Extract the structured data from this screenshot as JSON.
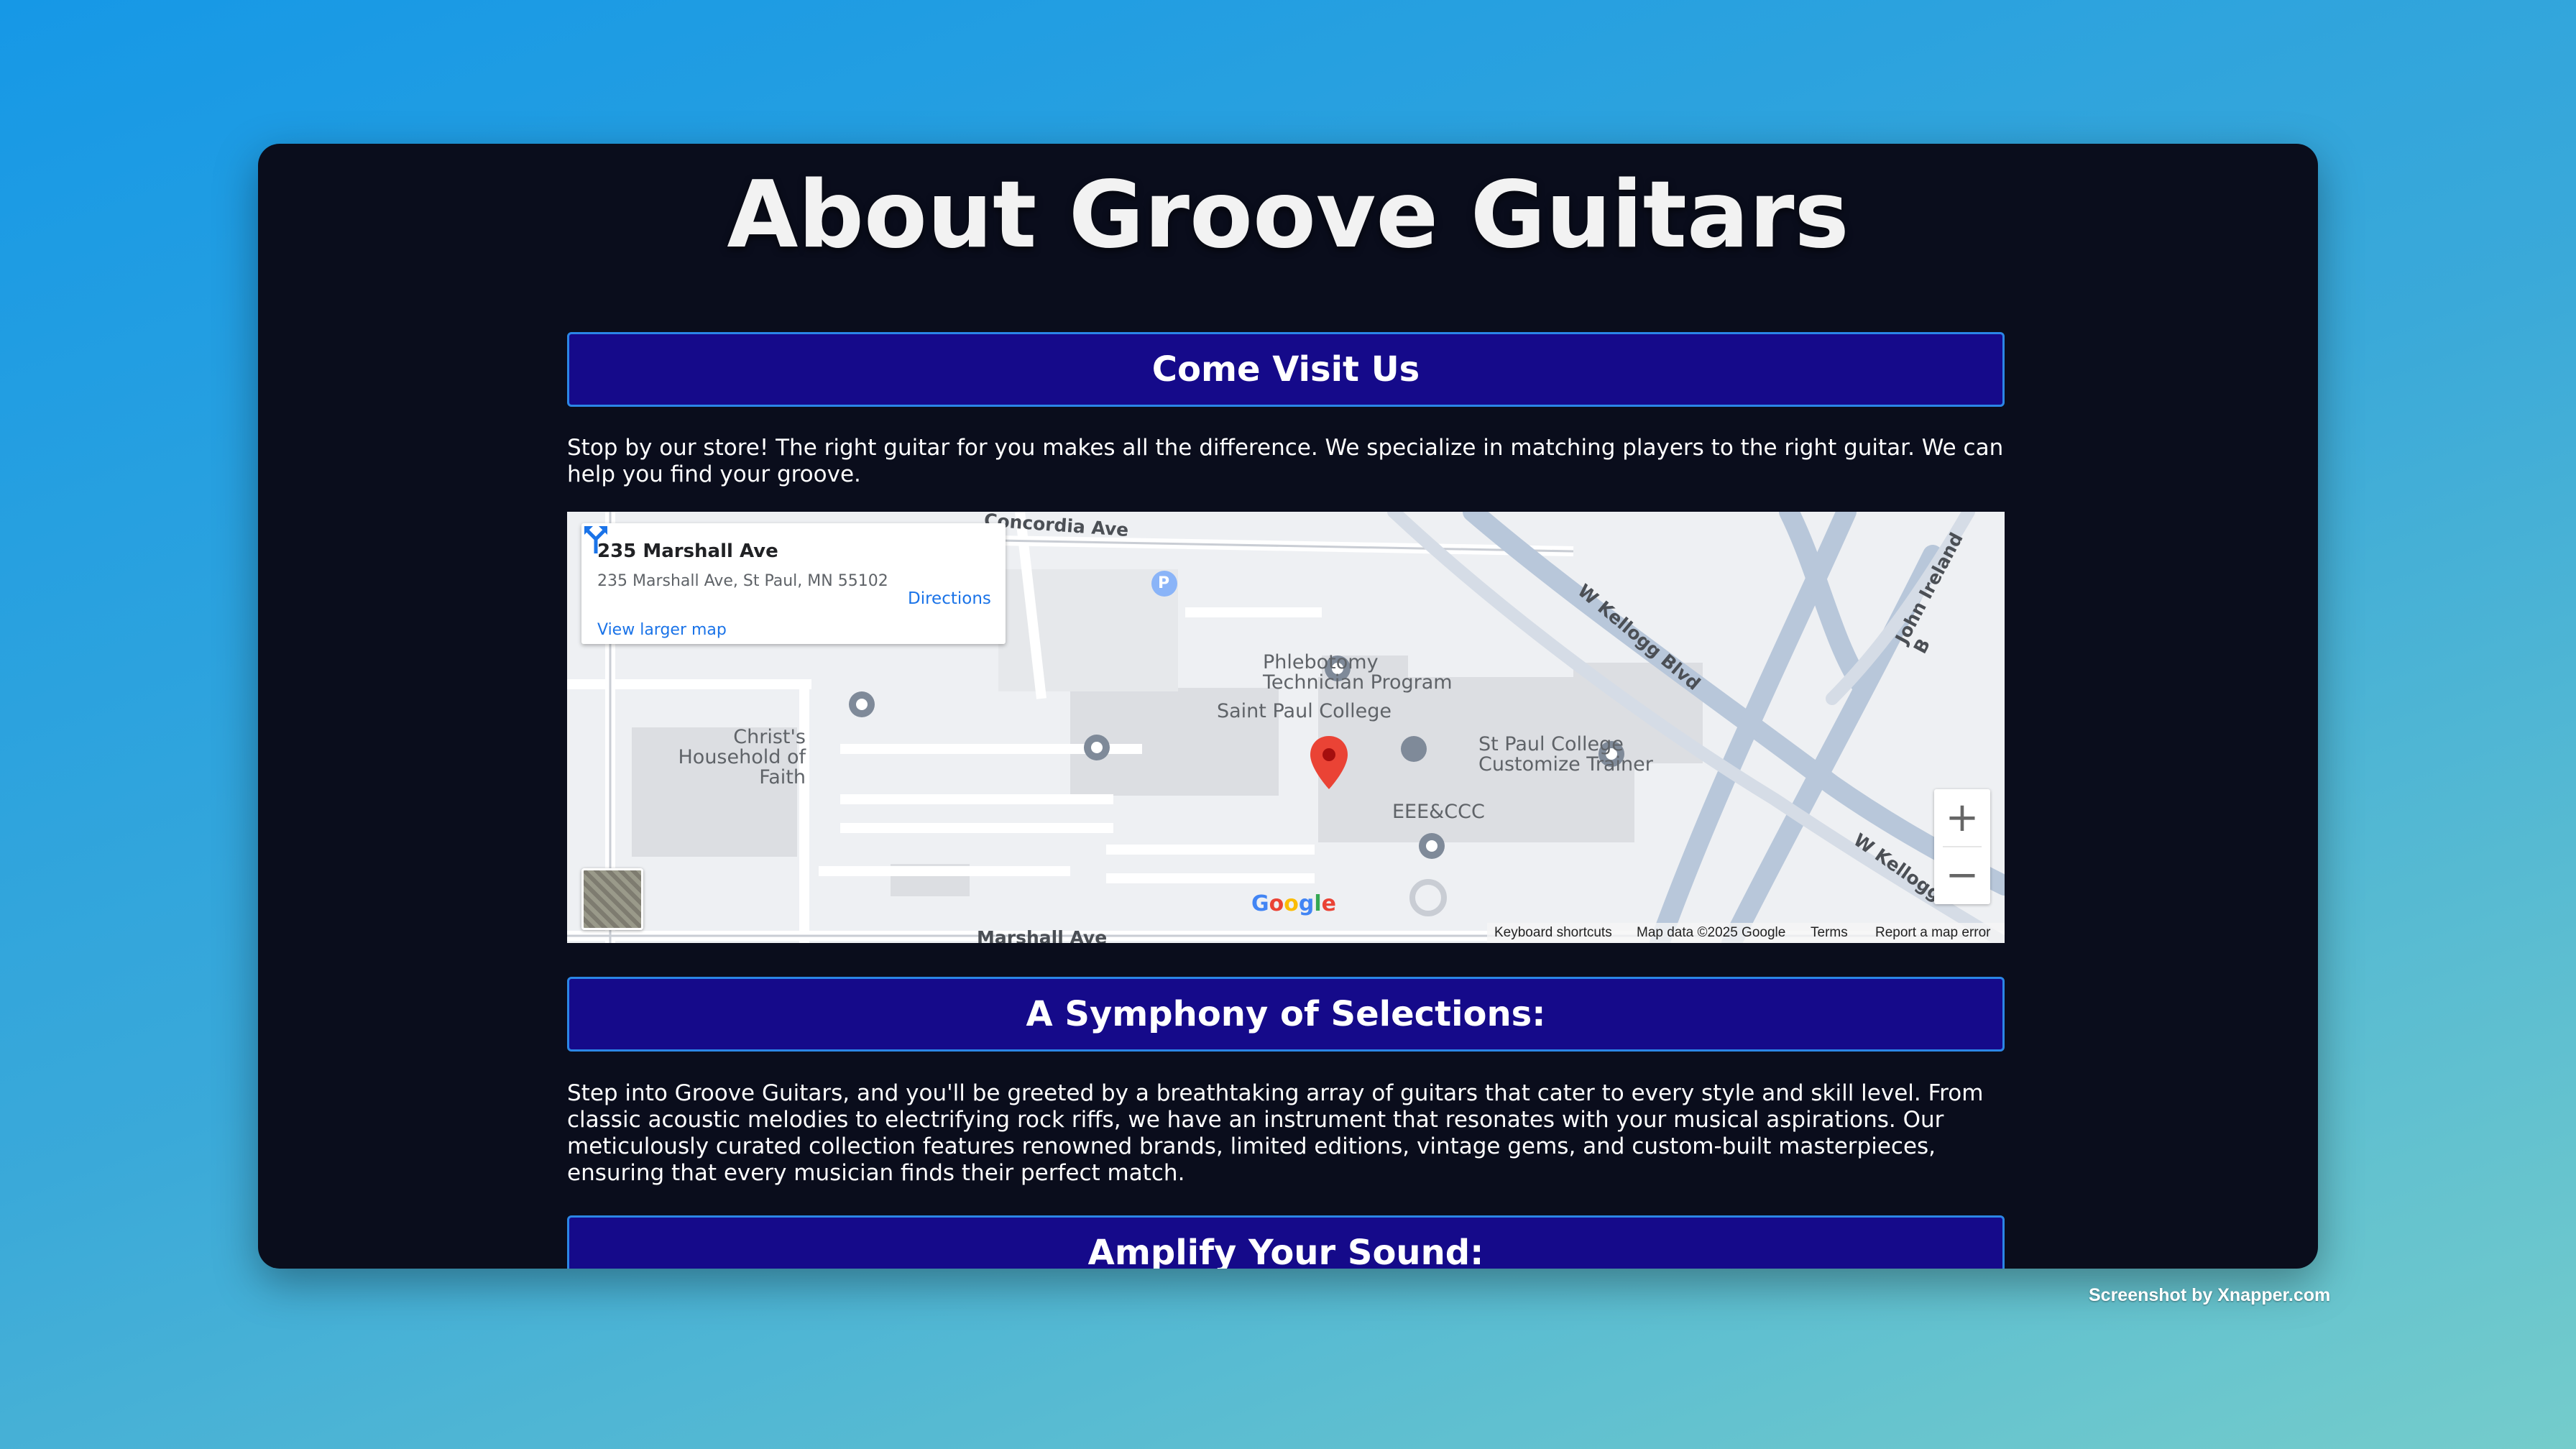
{
  "page": {
    "title": "About Groove Guitars"
  },
  "sections": [
    {
      "heading": "Come Visit Us",
      "body": "Stop by our store! The right guitar for you makes all the difference. We specialize in matching players to the right guitar. We can help you find your groove."
    },
    {
      "heading": "A Symphony of Selections:",
      "body": "Step into Groove Guitars, and you'll be greeted by a breathtaking array of guitars that cater to every style and skill level. From classic acoustic melodies to electrifying rock riffs, we have an instrument that resonates with your musical aspirations. Our meticulously curated collection features renowned brands, limited editions, vintage gems, and custom-built masterpieces, ensuring that every musician finds their perfect match."
    },
    {
      "heading": "Amplify Your Sound:"
    }
  ],
  "map": {
    "info_card": {
      "title": "235 Marshall Ave",
      "address": "235 Marshall Ave, St Paul, MN 55102",
      "directions_label": "Directions",
      "larger_map_link": "View larger map"
    },
    "places": {
      "phlebotomy": "Phlebotomy Technician Program",
      "college": "Saint Paul College",
      "church": "Christ's Household of Faith",
      "trainer": "St Paul College Customize Trainer",
      "eee": "EEE&CCC"
    },
    "roads": {
      "concordia": "Concordia Ave",
      "kellogg": "W Kellogg Blvd",
      "kellogg2": "W Kellogg",
      "ireland": "John Ireland B",
      "marshall": "Marshall Ave"
    },
    "parking": "P",
    "logo": "Google",
    "attribution": {
      "shortcuts": "Keyboard shortcuts",
      "map_data": "Map data ©2025 Google",
      "terms": "Terms",
      "report": "Report a map error"
    },
    "zoom_in": "+",
    "zoom_out": "−",
    "pin_color": "#ea4335"
  },
  "watermark": "Screenshot by Xnapper.com"
}
